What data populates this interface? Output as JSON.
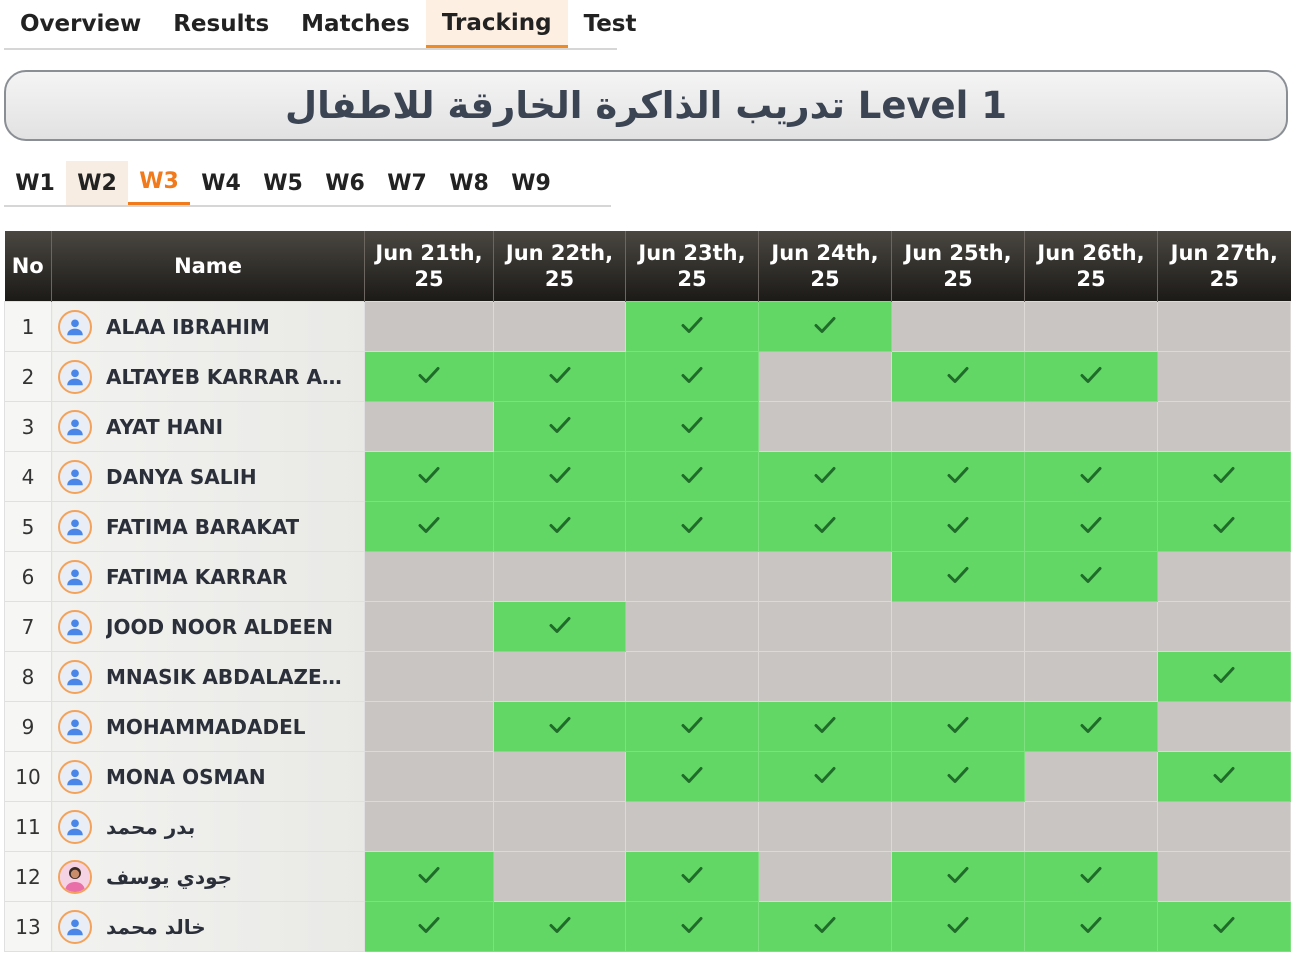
{
  "top_tabs": [
    {
      "label": "Overview",
      "active": false
    },
    {
      "label": "Results",
      "active": false
    },
    {
      "label": "Matches",
      "active": false
    },
    {
      "label": "Tracking",
      "active": true
    },
    {
      "label": "Test",
      "active": false
    }
  ],
  "title": "تدريب الذاكرة الخارقة للاطفال Level 1",
  "week_tabs": [
    {
      "label": "W1",
      "state": ""
    },
    {
      "label": "W2",
      "state": "hover"
    },
    {
      "label": "W3",
      "state": "active"
    },
    {
      "label": "W4",
      "state": ""
    },
    {
      "label": "W5",
      "state": ""
    },
    {
      "label": "W6",
      "state": ""
    },
    {
      "label": "W7",
      "state": ""
    },
    {
      "label": "W8",
      "state": ""
    },
    {
      "label": "W9",
      "state": ""
    }
  ],
  "table": {
    "col_no": "No",
    "col_name": "Name",
    "dates": [
      [
        "Jun 21th,",
        "25"
      ],
      [
        "Jun 22th,",
        "25"
      ],
      [
        "Jun 23th,",
        "25"
      ],
      [
        "Jun 24th,",
        "25"
      ],
      [
        "Jun 25th,",
        "25"
      ],
      [
        "Jun 26th,",
        "25"
      ],
      [
        "Jun 27th,",
        "25"
      ]
    ],
    "rows": [
      {
        "no": "1",
        "name": "ALAA IBRAHIM",
        "avatar": "default",
        "days": [
          0,
          0,
          1,
          1,
          0,
          0,
          0
        ]
      },
      {
        "no": "2",
        "name": "ALTAYEB KARRAR ALT...",
        "avatar": "default",
        "days": [
          1,
          1,
          1,
          0,
          1,
          1,
          0
        ]
      },
      {
        "no": "3",
        "name": "AYAT HANI",
        "avatar": "default",
        "days": [
          0,
          1,
          1,
          0,
          0,
          0,
          0
        ]
      },
      {
        "no": "4",
        "name": "DANYA SALIH",
        "avatar": "default",
        "days": [
          1,
          1,
          1,
          1,
          1,
          1,
          1
        ]
      },
      {
        "no": "5",
        "name": "FATIMA BARAKAT",
        "avatar": "default",
        "days": [
          1,
          1,
          1,
          1,
          1,
          1,
          1
        ]
      },
      {
        "no": "6",
        "name": "FATIMA KARRAR",
        "avatar": "default",
        "days": [
          0,
          0,
          0,
          0,
          1,
          1,
          0
        ]
      },
      {
        "no": "7",
        "name": "JOOD NOOR ALDEEN",
        "avatar": "default",
        "days": [
          0,
          1,
          0,
          0,
          0,
          0,
          0
        ]
      },
      {
        "no": "8",
        "name": "MNASIK ABDALAZEEM",
        "avatar": "default",
        "days": [
          0,
          0,
          0,
          0,
          0,
          0,
          1
        ]
      },
      {
        "no": "9",
        "name": "MOHAMMADADEL",
        "avatar": "default",
        "days": [
          0,
          1,
          1,
          1,
          1,
          1,
          0
        ]
      },
      {
        "no": "10",
        "name": "MONA OSMAN",
        "avatar": "default",
        "days": [
          0,
          0,
          1,
          1,
          1,
          0,
          1
        ]
      },
      {
        "no": "11",
        "name": "بدر محمد",
        "avatar": "default",
        "days": [
          0,
          0,
          0,
          0,
          0,
          0,
          0
        ]
      },
      {
        "no": "12",
        "name": "جودي يوسف",
        "avatar": "photo",
        "days": [
          1,
          0,
          1,
          0,
          1,
          1,
          0
        ]
      },
      {
        "no": "13",
        "name": "خالد محمد",
        "avatar": "default",
        "days": [
          1,
          1,
          1,
          1,
          1,
          1,
          1
        ]
      }
    ]
  },
  "icons": {
    "check": "check-icon",
    "avatar": "user-avatar-icon"
  },
  "colors": {
    "accent": "#f07a1c",
    "present": "#63d765",
    "absent": "#c9c5c2",
    "header": "#2b2925"
  }
}
